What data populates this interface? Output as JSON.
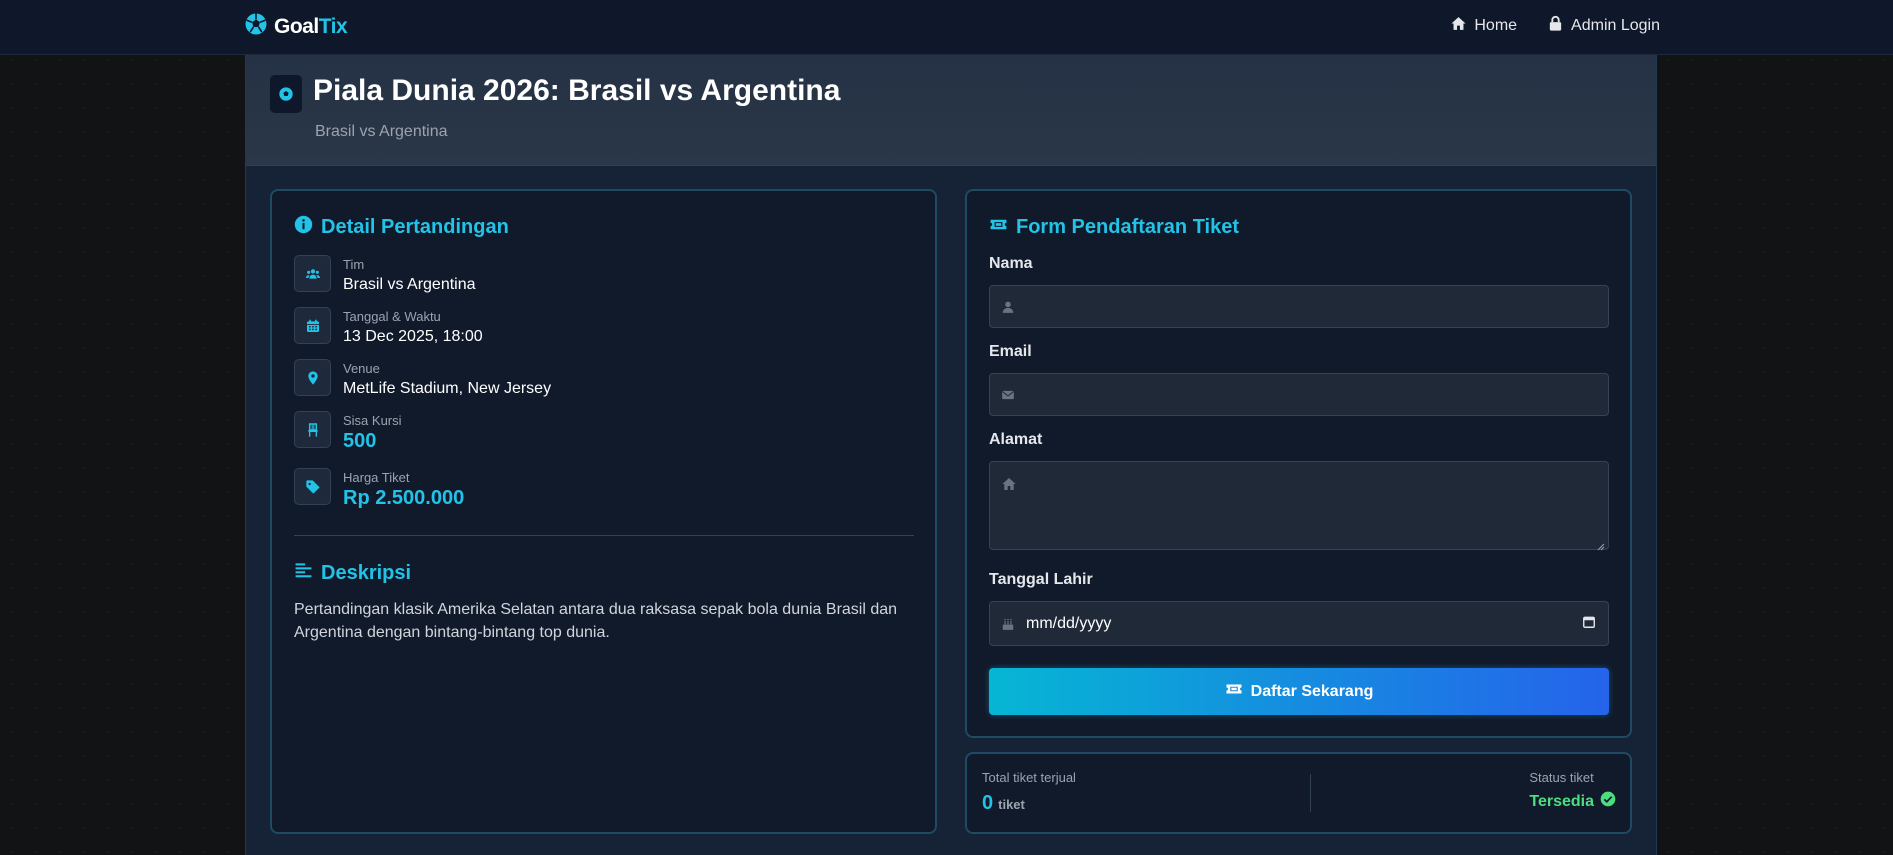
{
  "brand": {
    "part1": "Goal",
    "part2": "Tix",
    "icon": "soccer-ball-icon"
  },
  "nav": {
    "home": "Home",
    "admin_login": "Admin Login"
  },
  "hero": {
    "title": "Piala Dunia 2026: Brasil vs Argentina",
    "subtitle": "Brasil vs Argentina"
  },
  "details": {
    "title": "Detail Pertandingan",
    "items": [
      {
        "label": "Tim",
        "value": "Brasil vs Argentina",
        "icon": "users-icon"
      },
      {
        "label": "Tanggal & Waktu",
        "value": "13 Dec 2025, 18:00",
        "icon": "calendar-icon"
      },
      {
        "label": "Venue",
        "value": "MetLife Stadium, New Jersey",
        "icon": "map-pin-icon"
      },
      {
        "label": "Sisa Kursi",
        "value": "500",
        "icon": "chair-icon"
      },
      {
        "label": "Harga Tiket",
        "value": "Rp 2.500.000",
        "icon": "tag-icon"
      }
    ]
  },
  "description": {
    "title": "Deskripsi",
    "text": "Pertandingan klasik Amerika Selatan antara dua raksasa sepak bola dunia Brasil dan Argentina dengan bintang-bintang top dunia."
  },
  "form": {
    "title": "Form Pendaftaran Tiket",
    "fields": {
      "nama": {
        "label": "Nama",
        "value": "",
        "placeholder": ""
      },
      "email": {
        "label": "Email",
        "value": "",
        "placeholder": ""
      },
      "alamat": {
        "label": "Alamat",
        "value": "",
        "placeholder": ""
      },
      "tanggal_lahir": {
        "label": "Tanggal Lahir",
        "value": "mm/dd/yyyy"
      }
    },
    "submit_label": "Daftar Sekarang"
  },
  "stats": {
    "sold_label": "Total tiket terjual",
    "sold_value": "0",
    "sold_unit": "tiket",
    "status_label": "Status tiket",
    "status_value": "Tersedia"
  },
  "colors": {
    "accent": "#22c3e6",
    "success": "#4ade80",
    "navbar": "#0f172a",
    "card": "#111a2b"
  }
}
